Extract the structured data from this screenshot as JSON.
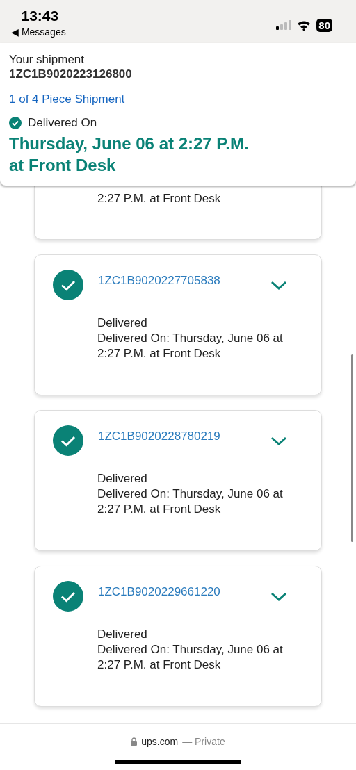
{
  "status_bar": {
    "time": "13:43",
    "back_label": "◀ Messages",
    "battery": "80"
  },
  "header": {
    "title": "Your shipment",
    "tracking_number": "1ZC1B9020223126800",
    "piece_link": "1 of 4 Piece Shipment",
    "status_label": "Delivered On",
    "delivery_date": "Thursday, June 06 at 2:27 P.M.",
    "delivery_place": "at Front Desk"
  },
  "packages": [
    {
      "partial": true,
      "detail_tail": "2:27 P.M. at Front Desk"
    },
    {
      "partial": false,
      "delivered": true,
      "tracking_number": "1ZC1B9020227705838",
      "status": "Delivered",
      "detail": "Delivered On: Thursday, June 06 at 2:27 P.M. at Front Desk"
    },
    {
      "partial": false,
      "delivered": true,
      "tracking_number": "1ZC1B9020228780219",
      "status": "Delivered",
      "detail": "Delivered On: Thursday, June 06 at 2:27 P.M. at Front Desk"
    },
    {
      "partial": false,
      "delivered": true,
      "tracking_number": "1ZC1B9020229661220",
      "status": "Delivered",
      "detail": "Delivered On: Thursday, June 06 at 2:27 P.M. at Front Desk"
    }
  ],
  "browser_bar": {
    "domain": "ups.com",
    "suffix": "— Private"
  }
}
